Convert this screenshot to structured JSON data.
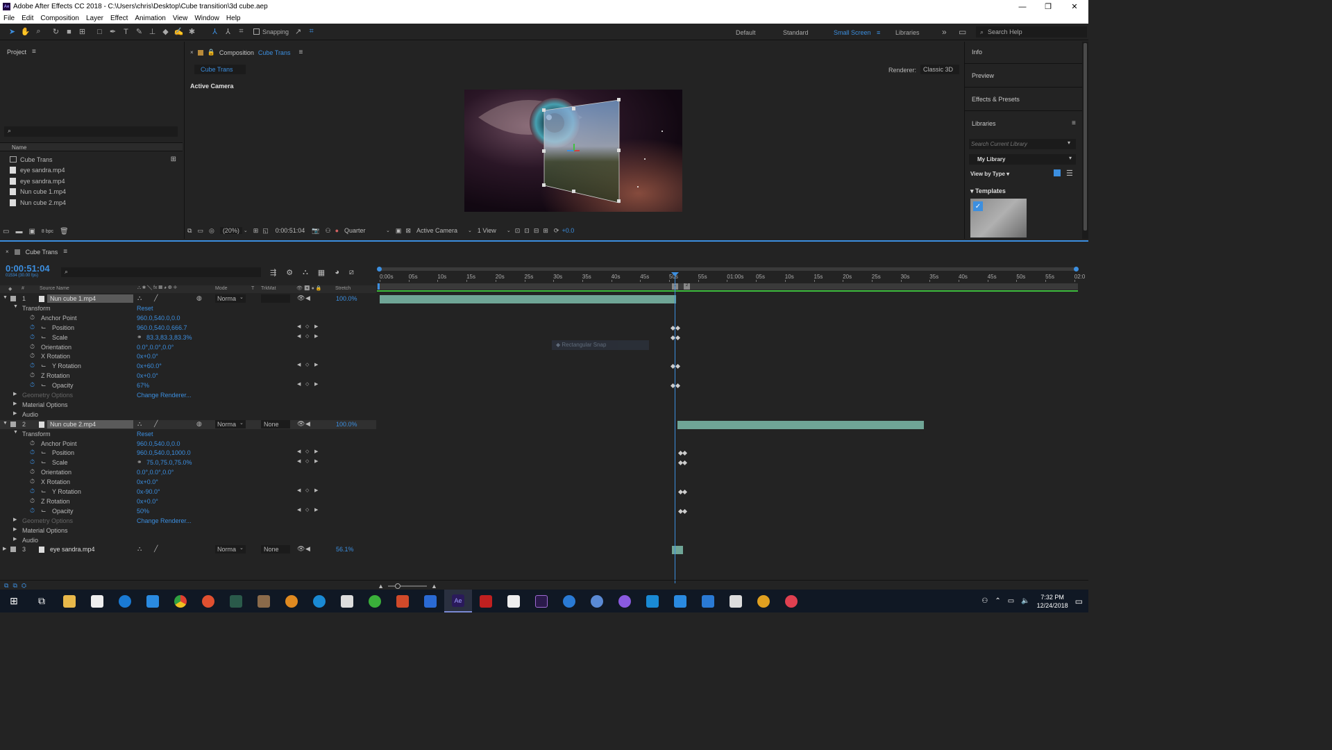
{
  "window": {
    "title": "Adobe After Effects CC 2018 - C:\\Users\\chris\\Desktop\\Cube transition\\3d cube.aep",
    "minimize": "—",
    "maximize": "❐",
    "close": "✕"
  },
  "menu": [
    "File",
    "Edit",
    "Composition",
    "Layer",
    "Effect",
    "Animation",
    "View",
    "Window",
    "Help"
  ],
  "toolbar": {
    "snapping": "Snapping",
    "workspaces": [
      "Default",
      "Standard",
      "Small Screen",
      "Libraries"
    ],
    "active_workspace": "Small Screen",
    "search_help": "Search Help"
  },
  "project": {
    "title": "Project",
    "search_placeholder": "",
    "col_name": "Name",
    "items": [
      "Cube Trans",
      "eye sandra.mp4",
      "eye sandra.mp4",
      "Nun cube 1.mp4",
      "Nun cube 2.mp4"
    ],
    "bpc": "8 bpc"
  },
  "composition": {
    "panel_label": "Composition",
    "name": "Cube Trans",
    "tab": "Cube Trans",
    "renderer_label": "Renderer:",
    "renderer": "Classic 3D",
    "view_label": "Active Camera",
    "footer": {
      "zoom": "(20%)",
      "time": "0:00:51:04",
      "resolution": "Quarter",
      "camera": "Active Camera",
      "views": "1 View",
      "exposure": "+0.0"
    }
  },
  "right_panel": {
    "items": [
      "Info",
      "Preview",
      "Effects & Presets",
      "Libraries"
    ],
    "search_placeholder": "Search Current Library",
    "library": "My Library",
    "view_by": "View by Type",
    "section": "Templates"
  },
  "timeline": {
    "tab": "Cube Trans",
    "timecode": "0:00:51:04",
    "fps_line": "01534 (30.00 fps)",
    "col_source": "Source Name",
    "col_mode": "Mode",
    "col_t": "T",
    "col_trkmat": "TrkMat",
    "col_stretch": "Stretch",
    "ruler": [
      "0:00s",
      "05s",
      "10s",
      "15s",
      "20s",
      "25s",
      "30s",
      "35s",
      "40s",
      "45s",
      "50s",
      "55s",
      "01:00s",
      "05s",
      "10s",
      "15s",
      "20s",
      "25s",
      "30s",
      "35s",
      "40s",
      "45s",
      "50s",
      "55s",
      "02:0"
    ],
    "layers": [
      {
        "num": "1",
        "name": "Nun cube 1.mp4",
        "mode": "Norma",
        "trkmat": "",
        "stretch": "100.0%",
        "transform": "Transform",
        "reset": "Reset",
        "props": [
          {
            "name": "Anchor Point",
            "value": "960.0,540.0,0.0"
          },
          {
            "name": "Position",
            "value": "960.0,540.0,666.7"
          },
          {
            "name": "Scale",
            "value": "83.3,83.3,83.3%"
          },
          {
            "name": "Orientation",
            "value": "0.0°,0.0°,0.0°"
          },
          {
            "name": "X Rotation",
            "value": "0x+0.0°"
          },
          {
            "name": "Y Rotation",
            "value": "0x+60.0°"
          },
          {
            "name": "Z Rotation",
            "value": "0x+0.0°"
          },
          {
            "name": "Opacity",
            "value": "67%"
          }
        ],
        "geometry": "Geometry Options",
        "change_renderer": "Change Renderer...",
        "material": "Material Options",
        "audio": "Audio"
      },
      {
        "num": "2",
        "name": "Nun cube 2.mp4",
        "mode": "Norma",
        "trkmat": "None",
        "stretch": "100.0%",
        "transform": "Transform",
        "reset": "Reset",
        "props": [
          {
            "name": "Anchor Point",
            "value": "960.0,540.0,0.0"
          },
          {
            "name": "Position",
            "value": "960.0,540.0,1000.0"
          },
          {
            "name": "Scale",
            "value": "75.0,75.0,75.0%"
          },
          {
            "name": "Orientation",
            "value": "0.0°,0.0°,0.0°"
          },
          {
            "name": "X Rotation",
            "value": "0x+0.0°"
          },
          {
            "name": "Y Rotation",
            "value": "0x-90.0°"
          },
          {
            "name": "Z Rotation",
            "value": "0x+0.0°"
          },
          {
            "name": "Opacity",
            "value": "50%"
          }
        ],
        "geometry": "Geometry Options",
        "change_renderer": "Change Renderer...",
        "material": "Material Options",
        "audio": "Audio"
      },
      {
        "num": "3",
        "name": "eye sandra.mp4",
        "mode": "Norma",
        "trkmat": "None",
        "stretch": "56.1%"
      }
    ],
    "snap_tooltip": "Rectangular Snap"
  },
  "taskbar": {
    "time": "7:32 PM",
    "date": "12/24/2018"
  },
  "colors": {
    "accent": "#3c8fe0",
    "bar_green": "#6fa596",
    "playhead": "#3c8fe0"
  }
}
